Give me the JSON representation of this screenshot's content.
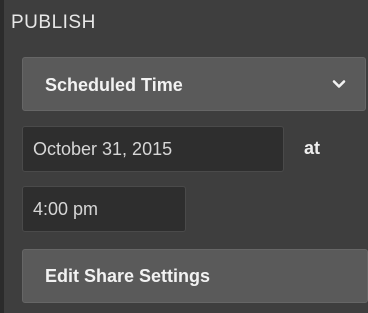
{
  "section": {
    "title": "PUBLISH"
  },
  "publish_mode": {
    "selected": "Scheduled Time",
    "icon": "chevron-down-icon"
  },
  "schedule": {
    "date_value": "October 31, 2015",
    "at_label": "at",
    "time_value": "4:00 pm"
  },
  "share": {
    "button_label": "Edit Share Settings"
  },
  "colors": {
    "panel_bg": "#3e3e3e",
    "control_bg": "#5a5a5a",
    "input_bg": "#2e2e2e",
    "text": "#f2f2f2"
  }
}
